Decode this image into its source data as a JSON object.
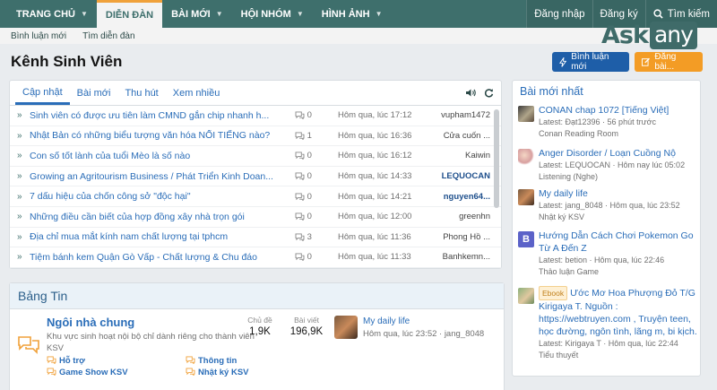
{
  "nav": {
    "tabs": [
      {
        "label": "TRANG CHỦ",
        "has_caret": true
      },
      {
        "label": "DIỄN ĐÀN",
        "has_caret": false
      },
      {
        "label": "BÀI MỚI",
        "has_caret": true
      },
      {
        "label": "HỘI NHÓM",
        "has_caret": true
      },
      {
        "label": "HÌNH ẢNH",
        "has_caret": true
      }
    ],
    "login": "Đăng nhập",
    "register": "Đăng ký",
    "search": "Tìm kiếm"
  },
  "subnav": {
    "items": [
      "Bình luận mới",
      "Tìm diễn đàn"
    ]
  },
  "logo": {
    "ask": "Ask",
    "any": "any"
  },
  "page": {
    "title": "Kênh Sinh Viên",
    "btn_new_comments": "Bình luận mới",
    "btn_post": "Đăng bài..."
  },
  "activity": {
    "tabs": [
      "Cập nhật",
      "Bài mới",
      "Thu hút",
      "Xem nhiều"
    ],
    "rows": [
      {
        "title": "Sinh viên có được ưu tiên làm CMND gắn chip nhanh h...",
        "replies": "0",
        "time": "Hôm qua, lúc 17:12",
        "user": "vupham1472",
        "bold": false
      },
      {
        "title": "Nhật Bản có những biểu tượng văn hóa NỔI TIẾNG nào?",
        "replies": "1",
        "time": "Hôm qua, lúc 16:36",
        "user": "Cửa cuốn ...",
        "bold": false
      },
      {
        "title": "Con số tốt lành của tuổi Mèo là số nào",
        "replies": "0",
        "time": "Hôm qua, lúc 16:12",
        "user": "Kaiwin",
        "bold": false
      },
      {
        "title": "Growing an Agritourism Business / Phát Triển Kinh Doan...",
        "replies": "0",
        "time": "Hôm qua, lúc 14:33",
        "user": "LEQUOCAN",
        "bold": true
      },
      {
        "title": "7 dấu hiệu của chốn công sở \"độc hại\"",
        "replies": "0",
        "time": "Hôm qua, lúc 14:21",
        "user": "nguyen64...",
        "bold": true
      },
      {
        "title": "Những điều cần biết của hợp đồng xây nhà trọn gói",
        "replies": "0",
        "time": "Hôm qua, lúc 12:00",
        "user": "greenhn",
        "bold": false
      },
      {
        "title": "Địa chỉ mua mắt kính nam chất lượng tại tphcm",
        "replies": "3",
        "time": "Hôm qua, lúc 11:36",
        "user": "Phong Hồ ...",
        "bold": false
      },
      {
        "title": "Tiệm bánh kem Quận Gò Vấp - Chất lượng & Chu đáo",
        "replies": "0",
        "time": "Hôm qua, lúc 11:33",
        "user": "Banhkemn...",
        "bold": false
      }
    ]
  },
  "board": {
    "heading": "Bảng Tin",
    "forum": {
      "title": "Ngôi nhà chung",
      "desc": "Khu vực sinh hoạt nội bộ chỉ dành riêng cho thành viên KSV",
      "threads_label": "Chủ đề",
      "threads_value": "1,9K",
      "posts_label": "Bài viết",
      "posts_value": "196,9K",
      "subforums": [
        "Hỗ trợ",
        "Thông tin",
        "Game Show KSV",
        "Nhật ký KSV"
      ],
      "last_title": "My daily life",
      "last_meta": "Hôm qua, lúc 23:52 · jang_8048"
    }
  },
  "sidebar": {
    "heading": "Bài mới nhất",
    "items": [
      {
        "title": "CONAN chap 1072 [Tiếng Việt]",
        "meta": "Latest: Đạt12396 · 56 phút trước",
        "forum": "Conan Reading Room",
        "badge": ""
      },
      {
        "title": "Anger Disorder / Loạn Cuồng Nộ",
        "meta": "Latest: LEQUOCAN · Hôm nay lúc 05:02",
        "forum": "Listening (Nghe)",
        "badge": ""
      },
      {
        "title": "My daily life",
        "meta": "Latest: jang_8048 · Hôm qua, lúc 23:52",
        "forum": "Nhật ký KSV",
        "badge": ""
      },
      {
        "title": "Hướng Dẫn Cách Chơi Pokemon Go Từ A Đến Z",
        "meta": "Latest: betion · Hôm qua, lúc 22:46",
        "forum": "Thảo luận Game",
        "badge": ""
      },
      {
        "title": "Ước Mơ Hoa Phượng Đỏ T/G Kirigaya T. Nguồn : https://webtruyen.com , Truyện teen, học đường, ngôn tình, lãng m, bi kịch.",
        "meta": "Latest: Kirigaya T · Hôm qua, lúc 22:44",
        "forum": "Tiểu thuyết",
        "badge": "Ebook"
      }
    ]
  },
  "colors": {
    "nav_bg": "#3e6f6c",
    "accent_orange": "#f0a13a",
    "link_blue": "#2a6db8",
    "btn_blue": "#1e5ea8",
    "btn_orange": "#f39c25"
  }
}
